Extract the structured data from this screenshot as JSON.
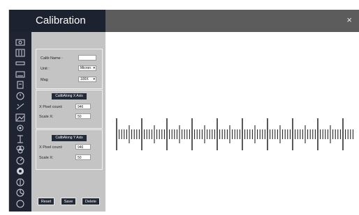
{
  "window": {
    "title": "Calibration",
    "close_glyph": "×"
  },
  "toolbar": {
    "icons": [
      "camera-icon",
      "sliders-icon",
      "ruler-icon",
      "layers-icon",
      "document-icon",
      "clock-icon",
      "magic-icon",
      "image-icon",
      "settings-icon",
      "measure-icon",
      "circles-icon",
      "gauge-icon",
      "target-icon",
      "dollar-circle-icon",
      "pie-icon",
      "circle-icon"
    ]
  },
  "calib": {
    "name_label": "Calib Name :",
    "name_value": "",
    "unit_label": "Unit :",
    "unit_value": "Micron",
    "mag_label": "Mag",
    "mag_value": "100X"
  },
  "x_axis": {
    "button": "CalibAlong X Axis",
    "pixel_label": "X Pixel count:",
    "pixel_value": "946",
    "scale_label": "Scale X:",
    "scale_value": "50"
  },
  "y_axis": {
    "button": "CalibAlong Y Axis",
    "pixel_label": "X Pixel count:",
    "pixel_value": "946",
    "scale_label": "Scale X:",
    "scale_value": "50"
  },
  "actions": {
    "reset": "Reset",
    "save": "Save",
    "delete": "Delete"
  },
  "colors": {
    "sidebar": "#1f2433",
    "panel": "#c4c4c4",
    "titlebar_gray": "#5c5c5c",
    "button": "#232a38"
  }
}
